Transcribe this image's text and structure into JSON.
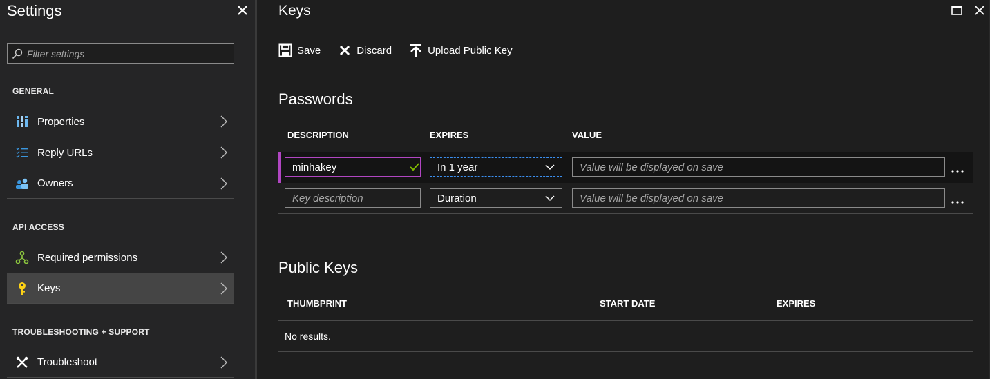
{
  "left_blade": {
    "title": "Settings",
    "filter": {
      "placeholder": "Filter settings",
      "value": ""
    },
    "sections": [
      {
        "label": "GENERAL",
        "items": [
          {
            "label": "Properties",
            "icon": "properties-icon"
          },
          {
            "label": "Reply URLs",
            "icon": "list-icon"
          },
          {
            "label": "Owners",
            "icon": "users-icon"
          }
        ]
      },
      {
        "label": "API ACCESS",
        "items": [
          {
            "label": "Required permissions",
            "icon": "permissions-icon"
          },
          {
            "label": "Keys",
            "icon": "key-icon",
            "active": true
          }
        ]
      },
      {
        "label": "TROUBLESHOOTING + SUPPORT",
        "items": [
          {
            "label": "Troubleshoot",
            "icon": "wrench-icon"
          }
        ]
      }
    ]
  },
  "right_blade": {
    "title": "Keys",
    "toolbar": {
      "save_label": "Save",
      "discard_label": "Discard",
      "upload_label": "Upload Public Key"
    },
    "passwords": {
      "heading": "Passwords",
      "columns": [
        "DESCRIPTION",
        "EXPIRES",
        "VALUE"
      ],
      "rows": [
        {
          "description": "minhakey",
          "description_placeholder": "Key description",
          "expires": "In 1 year",
          "value_placeholder": "Value will be displayed on save",
          "more": "..."
        },
        {
          "description": "",
          "description_placeholder": "Key description",
          "expires": "Duration",
          "value_placeholder": "Value will be displayed on save",
          "more": "..."
        }
      ]
    },
    "public_keys": {
      "heading": "Public Keys",
      "columns": [
        "THUMBPRINT",
        "START DATE",
        "EXPIRES"
      ],
      "empty_text": "No results."
    }
  },
  "colors": {
    "background": "#1e1e1e",
    "panel": "#252526",
    "selected_nav": "#454545",
    "accent_purple": "#b146c2",
    "check_green": "#7fba00",
    "focus_blue": "#3b8ff0"
  }
}
